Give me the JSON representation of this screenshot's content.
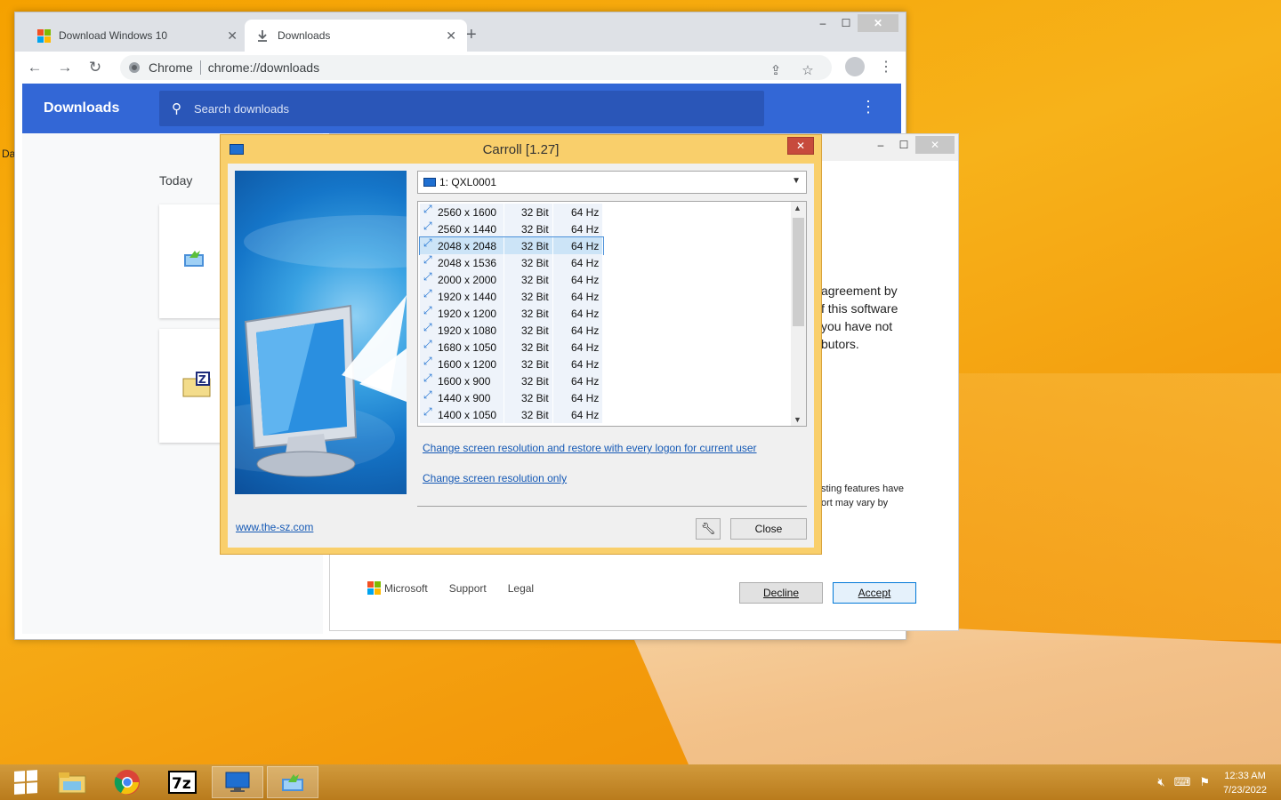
{
  "desktop": {
    "edge_label": "Da"
  },
  "chrome": {
    "tabs": [
      {
        "label": "Download Windows 10"
      },
      {
        "label": "Downloads"
      }
    ],
    "window_buttons": {
      "minimize": "–",
      "maximize": "☐",
      "close": "✕"
    },
    "omnibox": {
      "site_chip": "Chrome",
      "url": "chrome://downloads"
    },
    "downloads": {
      "title": "Downloads",
      "search_placeholder": "Search downloads",
      "section_label": "Today"
    }
  },
  "setup_window": {
    "agreement_lines": [
      "agreement by",
      "f this software",
      " you have not",
      "butors."
    ],
    "hosting_lines": [
      "sting features have",
      "ort may vary by"
    ],
    "footer": {
      "brand": "Microsoft",
      "support": "Support",
      "legal": "Legal"
    },
    "decline_label": "Decline",
    "accept_label": "Accept"
  },
  "carroll": {
    "title": "Carroll [1.27]",
    "display_select": "1: QXL0001",
    "resolutions": [
      {
        "res": "2560 x 1600",
        "bit": "32 Bit",
        "hz": "64 Hz"
      },
      {
        "res": "2560 x 1440",
        "bit": "32 Bit",
        "hz": "64 Hz"
      },
      {
        "res": "2048 x 2048",
        "bit": "32 Bit",
        "hz": "64 Hz",
        "selected": true
      },
      {
        "res": "2048 x 1536",
        "bit": "32 Bit",
        "hz": "64 Hz"
      },
      {
        "res": "2000 x 2000",
        "bit": "32 Bit",
        "hz": "64 Hz"
      },
      {
        "res": "1920 x 1440",
        "bit": "32 Bit",
        "hz": "64 Hz"
      },
      {
        "res": "1920 x 1200",
        "bit": "32 Bit",
        "hz": "64 Hz"
      },
      {
        "res": "1920 x 1080",
        "bit": "32 Bit",
        "hz": "64 Hz"
      },
      {
        "res": "1680 x 1050",
        "bit": "32 Bit",
        "hz": "64 Hz"
      },
      {
        "res": "1600 x 1200",
        "bit": "32 Bit",
        "hz": "64 Hz"
      },
      {
        "res": "1600 x 900",
        "bit": "32 Bit",
        "hz": "64 Hz"
      },
      {
        "res": "1440 x 900",
        "bit": "32 Bit",
        "hz": "64 Hz"
      },
      {
        "res": "1400 x 1050",
        "bit": "32 Bit",
        "hz": "64 Hz"
      }
    ],
    "link_restore": "Change screen resolution and restore with every logon for current user",
    "link_only": "Change screen resolution only",
    "website": "www.the-sz.com",
    "close_label": "Close"
  },
  "taskbar": {
    "clock_time": "12:33 AM",
    "clock_date": "7/23/2022",
    "icons": [
      "start-icon",
      "file-explorer-icon",
      "chrome-icon",
      "7zip-icon",
      "carroll-icon",
      "setup-icon"
    ]
  },
  "colors": {
    "chrome_header": "#3367d6",
    "carroll_frame": "#f9cf6b",
    "desktop": "#f5a100",
    "link": "#1559b5"
  }
}
